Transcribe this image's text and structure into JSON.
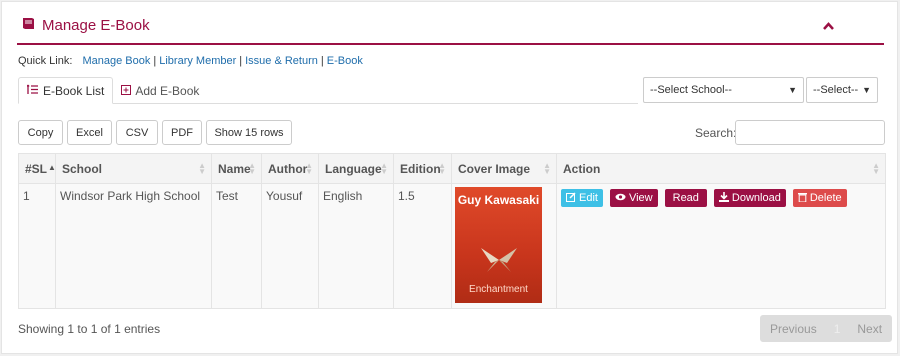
{
  "panel": {
    "title": "Manage E-Book"
  },
  "quick_link": {
    "label": "Quick Link:",
    "links": [
      "Manage Book",
      "Library Member",
      "Issue & Return",
      "E-Book"
    ]
  },
  "tabs": [
    {
      "label": "E-Book List",
      "icon": "list-icon",
      "active": true
    },
    {
      "label": "Add E-Book",
      "icon": "plus-square-icon",
      "active": false
    }
  ],
  "filters": {
    "school": "--Select School--",
    "other": "--Select--"
  },
  "export_buttons": [
    "Copy",
    "Excel",
    "CSV",
    "PDF",
    "Show 15 rows"
  ],
  "search": {
    "label": "Search:",
    "value": ""
  },
  "table": {
    "columns": [
      "#SL",
      "School",
      "Name",
      "Author",
      "Language",
      "Edition",
      "Cover Image",
      "Action"
    ],
    "rows": [
      {
        "sl": "1",
        "school": "Windsor Park High School",
        "name": "Test",
        "author": "Yousuf",
        "language": "English",
        "edition": "1.5",
        "cover": {
          "author": "Guy Kawasaki",
          "title": "Enchantment"
        }
      }
    ],
    "actions": [
      "Edit",
      "View",
      "Read",
      "Download",
      "Delete"
    ]
  },
  "footer": {
    "showing": "Showing 1 to 1 of 1 entries",
    "pager": {
      "prev": "Previous",
      "page": "1",
      "next": "Next"
    }
  },
  "colors": {
    "accent": "#9b1044",
    "edit": "#3ec0e6",
    "delete": "#dd4b4b"
  }
}
